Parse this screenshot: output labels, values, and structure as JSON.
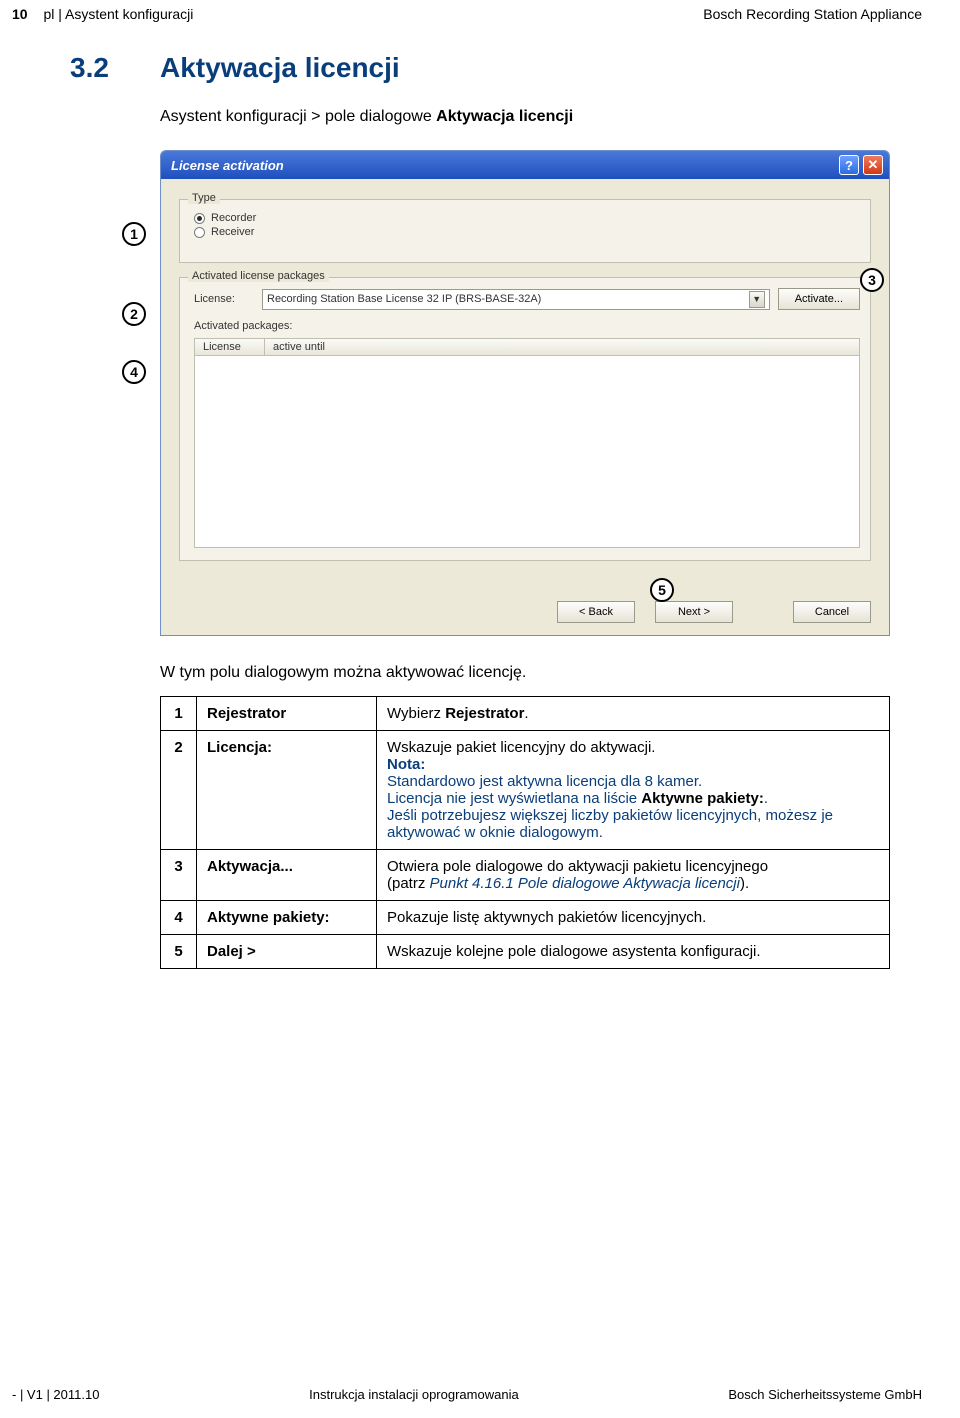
{
  "header": {
    "page_num": "10",
    "left": "pl | Asystent konfiguracji",
    "right": "Bosch Recording Station Appliance"
  },
  "section": {
    "number": "3.2",
    "title": "Aktywacja licencji",
    "path_prefix": "Asystent konfiguracji > pole dialogowe ",
    "path_bold": "Aktywacja licencji"
  },
  "dialog": {
    "title": "License activation",
    "help_glyph": "?",
    "close_glyph": "✕",
    "type_legend": "Type",
    "radio_recorder": "Recorder",
    "radio_receiver": "Receiver",
    "alp_legend": "Activated license packages",
    "license_label": "License:",
    "license_value": "Recording Station Base License 32 IP (BRS-BASE-32A)",
    "activate_btn": "Activate...",
    "activated_pkgs_label": "Activated packages:",
    "col_license": "License",
    "col_active_until": "active until",
    "back_btn": "< Back",
    "next_btn": "Next >",
    "cancel_btn": "Cancel"
  },
  "callouts": {
    "c1": "1",
    "c2": "2",
    "c3": "3",
    "c4": "4",
    "c5": "5"
  },
  "narrative": "W tym polu dialogowym można aktywować licencję.",
  "table": {
    "rows": [
      {
        "n": "1",
        "label": "Rejestrator",
        "desc_pre": "Wybierz ",
        "desc_bold": "Rejestrator",
        "desc_post": "."
      },
      {
        "n": "2",
        "label": "Licencja:",
        "line1": "Wskazuje pakiet licencyjny do aktywacji.",
        "nota": "Nota:",
        "line2": "Standardowo jest aktywna licencja dla 8 kamer.",
        "line3_pre": "Licencja nie jest wyświetlana na liście ",
        "line3_bold": "Aktywne pakiety:",
        "line3_post": ".",
        "line4": "Jeśli potrzebujesz większej liczby pakietów licencyjnych, możesz je aktywować w oknie dialogowym."
      },
      {
        "n": "3",
        "label": "Aktywacja...",
        "line1": "Otwiera pole dialogowe do aktywacji pakietu licencyjnego",
        "line2_pre": "(patrz ",
        "line2_link": "Punkt 4.16.1 Pole dialogowe Aktywacja licencji",
        "line2_post": ")."
      },
      {
        "n": "4",
        "label": "Aktywne pakiety:",
        "desc": "Pokazuje listę aktywnych pakietów licencyjnych."
      },
      {
        "n": "5",
        "label": "Dalej >",
        "desc": "Wskazuje kolejne pole dialogowe asystenta konfiguracji."
      }
    ]
  },
  "footer": {
    "left": "- | V1 | 2011.10",
    "center": "Instrukcja instalacji oprogramowania",
    "right": "Bosch Sicherheitssysteme GmbH"
  }
}
